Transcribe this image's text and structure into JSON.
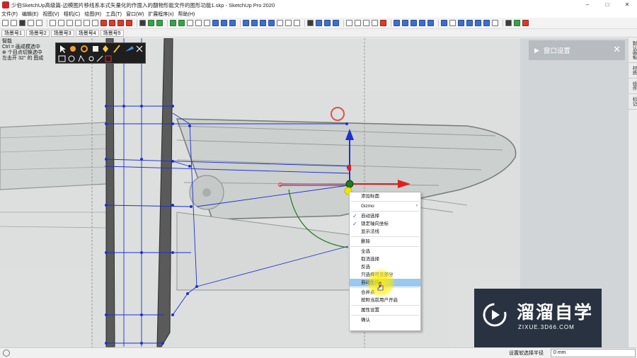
{
  "window": {
    "title": "少伯SketchUp高级篇-边模图片移线系本式矢量化的作面入的翻物形能文件的图形功能1.skp - SketchUp Pro 2020",
    "minimize": "–",
    "maximize": "□",
    "close": "✕"
  },
  "menu": {
    "items": [
      "文件(F)",
      "编辑(E)",
      "视图(V)",
      "相机(C)",
      "绘图(R)",
      "工具(T)",
      "窗口(W)",
      "扩展程序(x)",
      "帮助(H)"
    ]
  },
  "scenes": {
    "tabs": [
      "场景号1",
      "场景号2",
      "场景号3",
      "场景号4",
      "场景号5"
    ]
  },
  "instructions": {
    "lines": [
      "智能",
      "Ctrl = 画成模选中",
      "⊕ 个目点切换选中",
      "左击开 32° 的 图成"
    ]
  },
  "tray": {
    "title": "窗口设置"
  },
  "right_tabs": [
    "默认面板",
    "材质",
    "组件",
    "标记"
  ],
  "context_menu": {
    "items": [
      {
        "label": "添加标面",
        "checked": false,
        "submenu": false
      },
      {
        "label": "Gizmo",
        "checked": false,
        "submenu": true
      },
      {
        "label": "自动选择",
        "checked": true,
        "submenu": false
      },
      {
        "label": "锁定轴向坐标",
        "checked": true,
        "submenu": false
      },
      {
        "label": "显示法线",
        "checked": false,
        "submenu": false
      },
      {
        "label": "删除",
        "checked": false,
        "submenu": false
      },
      {
        "label": "全选",
        "checked": false,
        "submenu": false
      },
      {
        "label": "取消选择",
        "checked": false,
        "submenu": false
      },
      {
        "label": "反选",
        "checked": false,
        "submenu": false
      },
      {
        "label": "只选择可见部分",
        "checked": false,
        "submenu": false
      },
      {
        "label": "自动生成",
        "checked": false,
        "submenu": false
      },
      {
        "label": "合并点",
        "checked": false,
        "submenu": false
      },
      {
        "label": "按照当前用户开启",
        "checked": false,
        "submenu": false
      },
      {
        "label": "属性设置",
        "checked": false,
        "submenu": false
      },
      {
        "label": "确认",
        "checked": false,
        "submenu": false
      }
    ],
    "highlighted_index": 10
  },
  "logo": {
    "brand": "溜溜自学",
    "url": "ZIXUE.3D66.COM"
  },
  "status": {
    "label": "设置软选择半径",
    "value": "0 mm"
  },
  "colors": {
    "tray_bg": "#d2d5d8",
    "tray_header": "#b7bcc1",
    "menu_highlight": "#99c9ef",
    "edge_blue": "#1d2fd6",
    "axis_red": "#e02020",
    "axis_blue": "#1d2fd6",
    "axis_green": "#1e7d1e",
    "logo_bg": "#293241"
  }
}
